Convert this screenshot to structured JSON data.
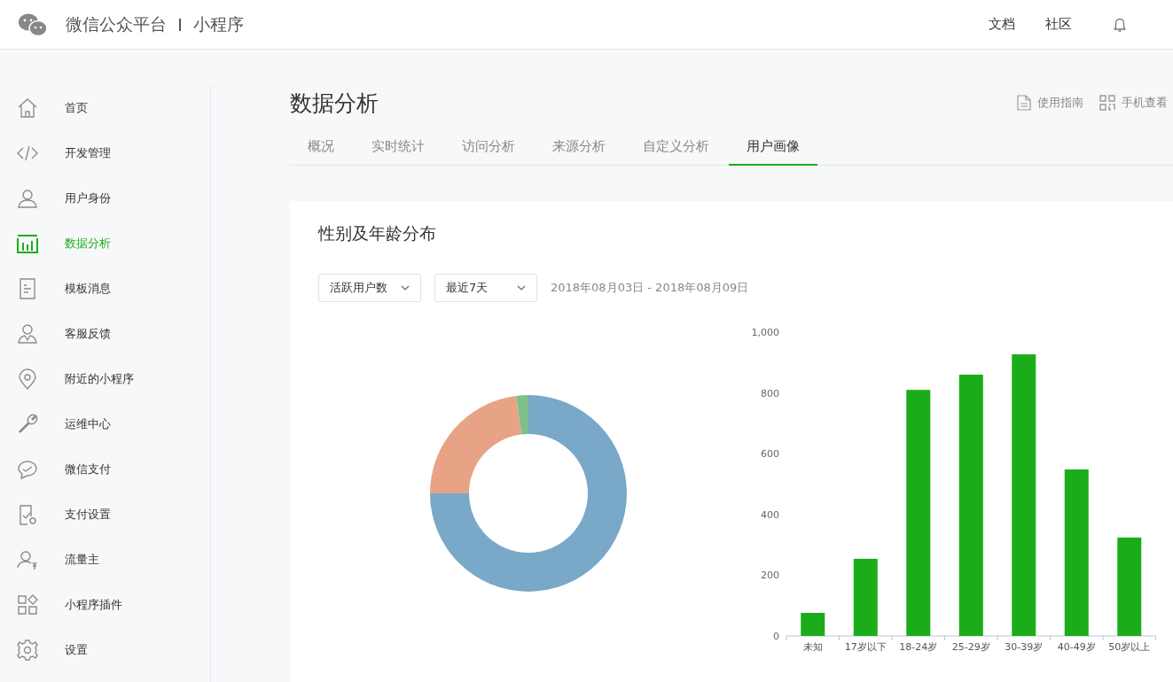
{
  "header": {
    "brand": "微信公众平台",
    "product": "小程序",
    "links": [
      "文档",
      "社区"
    ]
  },
  "sidebar": {
    "items": [
      {
        "kind": "home",
        "label": "首页",
        "selected": false
      },
      {
        "kind": "code",
        "label": "开发管理",
        "selected": false
      },
      {
        "kind": "user",
        "label": "用户身份",
        "selected": false
      },
      {
        "kind": "chart",
        "label": "数据分析",
        "selected": true
      },
      {
        "kind": "doc",
        "label": "模板消息",
        "selected": false
      },
      {
        "kind": "service",
        "label": "客服反馈",
        "selected": false
      },
      {
        "kind": "pin",
        "label": "附近的小程序",
        "selected": false
      },
      {
        "kind": "wrench",
        "label": "运维中心",
        "selected": false
      },
      {
        "kind": "pay",
        "label": "微信支付",
        "selected": false
      },
      {
        "kind": "paysettings",
        "label": "支付设置",
        "selected": false
      },
      {
        "kind": "yen",
        "label": "流量主",
        "selected": false
      },
      {
        "kind": "plugin",
        "label": "小程序插件",
        "selected": false
      },
      {
        "kind": "gear",
        "label": "设置",
        "selected": false
      }
    ]
  },
  "page": {
    "title": "数据分析",
    "actions": [
      {
        "kind": "guide",
        "label": "使用指南"
      },
      {
        "kind": "qr",
        "label": "手机查看"
      }
    ]
  },
  "tabs": [
    {
      "label": "概况",
      "selected": false
    },
    {
      "label": "实时统计",
      "selected": false
    },
    {
      "label": "访问分析",
      "selected": false
    },
    {
      "label": "来源分析",
      "selected": false
    },
    {
      "label": "自定义分析",
      "selected": false
    },
    {
      "label": "用户画像",
      "selected": true
    }
  ],
  "card": {
    "title": "性别及年龄分布",
    "filters": [
      {
        "value": "活跃用户数"
      },
      {
        "value": "最近7天"
      }
    ],
    "date_range": "2018年08月03日 - 2018年08月09日",
    "chart_data": {
      "type": "bar",
      "categories": [
        "未知",
        "17岁以下",
        "18-24岁",
        "25-29岁",
        "30-39岁",
        "40-49岁",
        "50岁以上"
      ],
      "values": [
        76,
        254,
        810,
        860,
        927,
        548,
        324
      ],
      "ylim": [
        0,
        1000
      ],
      "yticks": [
        0,
        200,
        400,
        600,
        800,
        {
          "value": 1000,
          "label": "1,000"
        }
      ]
    }
  }
}
